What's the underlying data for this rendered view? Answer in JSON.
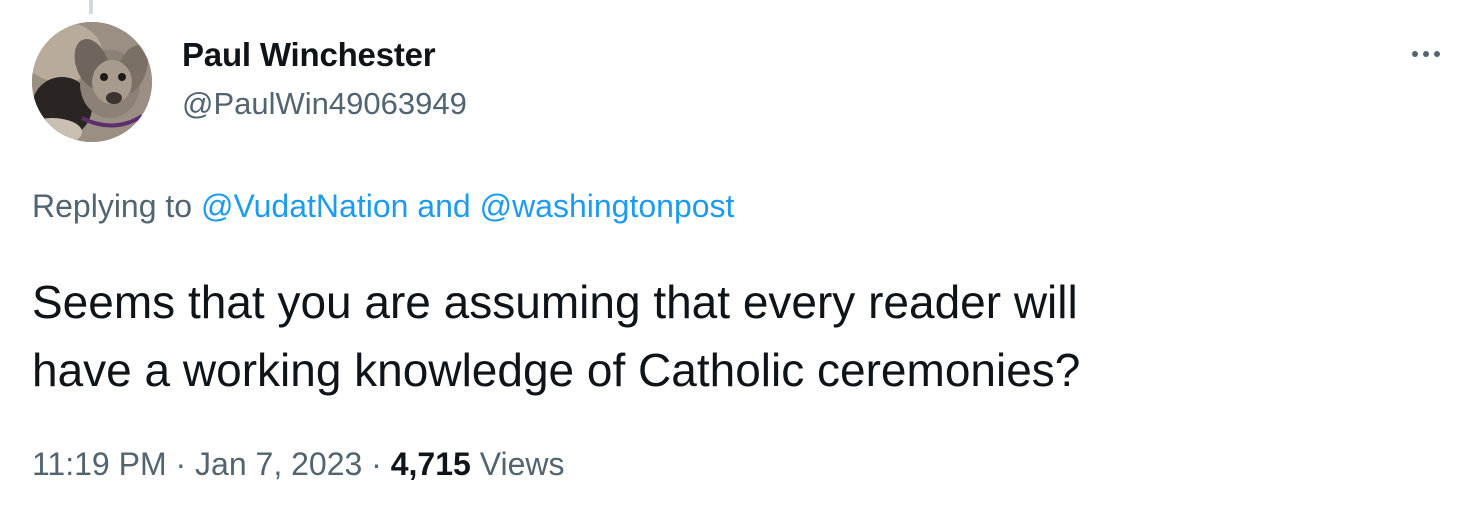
{
  "tweet": {
    "author": {
      "display_name": "Paul Winchester",
      "handle": "@PaulWin49063949"
    },
    "reply": {
      "prefix": "Replying to",
      "mention_1": "@VudatNation",
      "conjunction": "and",
      "mention_2": "@washingtonpost"
    },
    "text_lines": [
      "Seems that you are assuming that every reader will",
      "have a working knowledge of Catholic ceremonies?"
    ],
    "meta": {
      "time": "11:19 PM",
      "separator": "·",
      "date": "Jan 7, 2023",
      "views_count": "4,715",
      "views_label": "Views"
    },
    "icons": {
      "more": "more-horizontal-icon"
    },
    "colors": {
      "link": "#1d9bf0",
      "secondary_text": "#536471",
      "primary_text": "#0f1419"
    }
  }
}
